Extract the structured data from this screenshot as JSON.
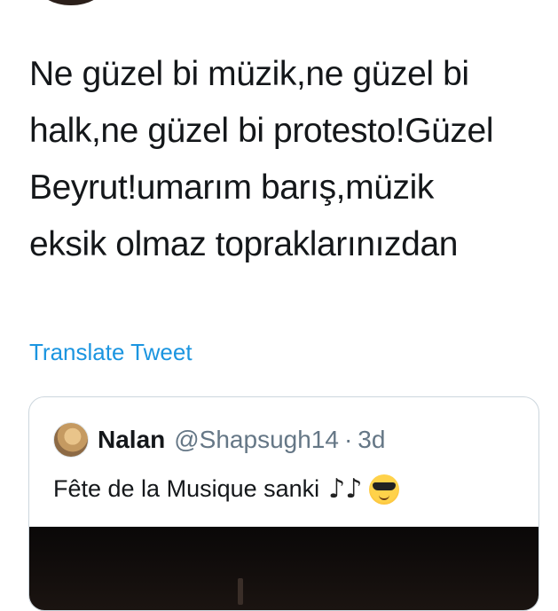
{
  "tweet": {
    "text": "Ne güzel bi müzik,ne güzel bi\nhalk,ne güzel bi protesto!Güzel\nBeyrut!umarım barış,müzik\neksik olmaz topraklarınızdan",
    "translate_label": "Translate Tweet"
  },
  "quote": {
    "name": "Nalan",
    "handle": "@Shapsugh14",
    "separator": "·",
    "time": "3d",
    "text": "Fête de la Musique sanki",
    "emojis": [
      "musical-notes-icon",
      "sunglasses-face-icon"
    ]
  },
  "colors": {
    "link": "#1b95e0",
    "text": "#14171a",
    "secondary": "#657786",
    "border": "#ccd6dd"
  }
}
